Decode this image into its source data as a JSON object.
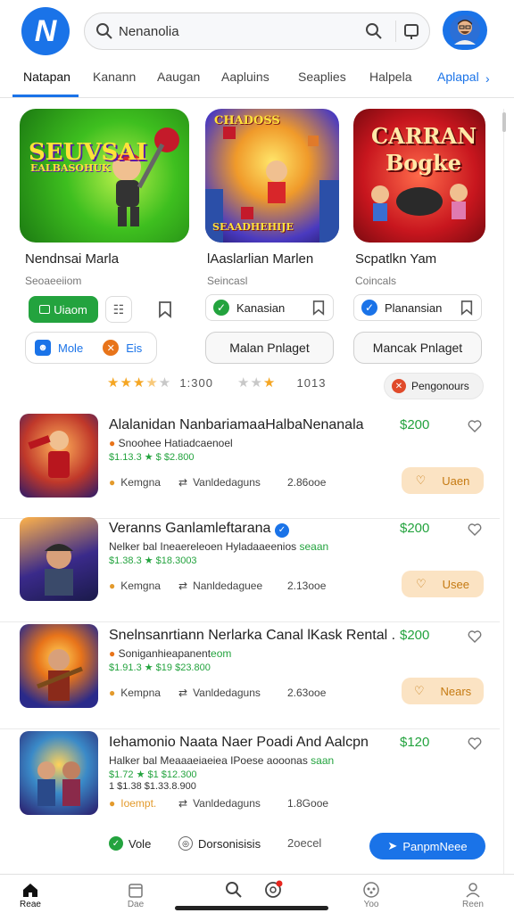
{
  "header": {
    "logo_letter": "N",
    "search_value": "Nenanolia"
  },
  "tabs": {
    "items": [
      "Natapan",
      "Kanann",
      "Aaugan",
      "Aapluins",
      "Seaplies",
      "Halpela",
      "Aplapal"
    ]
  },
  "featured": [
    {
      "art_text": "SEUVSAI",
      "art_sub": "EALBASOHUK",
      "title": "Nendnsai Marla",
      "sub": "Seoaeeiiom"
    },
    {
      "art_text": "CHADOSS",
      "art_sub": "SEAADHEHIJE",
      "title": "lAaslarlian Marlen",
      "sub": "Seincasl"
    },
    {
      "art_text": "CARRAN",
      "art_sub": "Bogke",
      "title": "Scpatlkn Yam",
      "sub": "Coincals"
    }
  ],
  "actions": {
    "chip1": "Uiaom",
    "chip2_label": "Kanasian",
    "chip3_label": "Planansian",
    "pill_left_a": "Mole",
    "pill_left_b": "Eis",
    "outline_btn_1": "Malan Pnlaget",
    "outline_btn_2": "Mancak Pnlaget",
    "rating_1_text": "1:300",
    "rating_2_text": "1013",
    "pengonours": "Pengonours"
  },
  "items": [
    {
      "name": "Alalanidan NanbariamaaHalbaNenanala",
      "line2a": "Snoohee Hatiadcaenoel",
      "line3": "$1.13.3 ★ $ $2.800",
      "price": "$200",
      "meta1": "Kemgna",
      "meta2": "Vanldedaguns",
      "meta3": "2.86ooe",
      "buy": "Uaen"
    },
    {
      "name": "Veranns Ganlamleftarana",
      "line2a": "Nelker bal Ineaereleoen Hyladaaeenios",
      "line2b": "seaan",
      "line3": "$1.38.3 ★ $18.3003",
      "price": "$200",
      "meta1": "Kemgna",
      "meta2": "Nanldedaguee",
      "meta3": "2.13ooe",
      "buy": "Usee"
    },
    {
      "name": "Snelnsanrtiann Nerlarka Canal lKask Rental .",
      "line2a": "Soniganhieapanent",
      "line2b": "eom",
      "line3": "$1.91.3 ★ $19 $23.800",
      "price": "$200",
      "meta1": "Kempna",
      "meta2": "Vanldedaguns",
      "meta3": "2.63ooe",
      "buy": "Nears"
    },
    {
      "name": "Iehamonio Naata Naer Poadi  And Aalcpn",
      "line2a": "Halker bal Meaaaeiaeiea IPoese aooonas",
      "line2b": "saan",
      "line3": "$1.72 ★ $1 $12.300",
      "line4": "1 $1.38 $1.33.8.900",
      "price": "$120",
      "meta1": "Ioempt.",
      "meta2": "Vanldedaguns",
      "meta3": "1.8Gooe",
      "buy": ""
    }
  ],
  "bottom_actions": {
    "vole": "Vole",
    "dorsonisis": "Dorsonisisis",
    "zoecel": "2oecel",
    "primary": "PanpmNeee"
  },
  "nav": [
    "Reae",
    "Dae",
    "",
    "",
    "Yoo",
    "Reen"
  ]
}
